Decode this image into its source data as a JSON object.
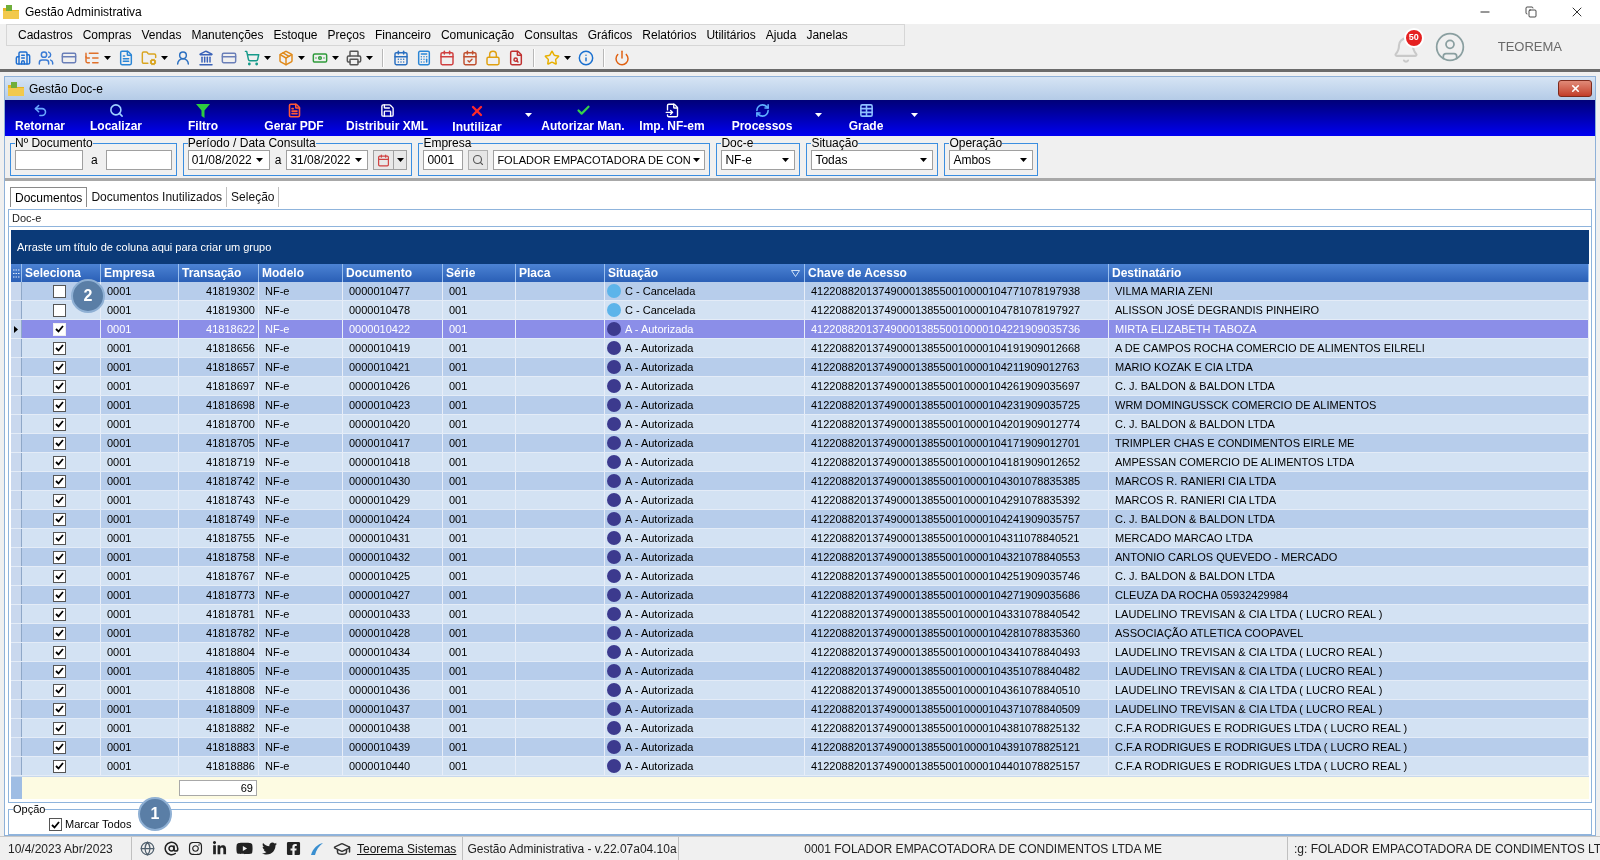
{
  "window": {
    "title": "Gestão Administrativa"
  },
  "menu": [
    "Cadastros",
    "Compras",
    "Vendas",
    "Manutenções",
    "Estoque",
    "Preços",
    "Financeiro",
    "Comunicação",
    "Consultas",
    "Gráficos",
    "Relatórios",
    "Utilitários",
    "Ajuda",
    "Janelas"
  ],
  "notifications": {
    "count": "50"
  },
  "user": {
    "name": "TEOREMA"
  },
  "doc_window": {
    "title": "Gestão Doc-e",
    "toolbar": [
      {
        "label": "Retornar",
        "dropdown": false
      },
      {
        "label": "Localizar",
        "dropdown": false
      },
      {
        "label": "Filtro",
        "dropdown": false
      },
      {
        "label": "Gerar PDF",
        "dropdown": false
      },
      {
        "label": "Distribuir XML",
        "dropdown": false
      },
      {
        "label": "Inutilizar",
        "dropdown": true
      },
      {
        "label": "Autorizar Man.",
        "dropdown": false
      },
      {
        "label": "Imp. NF-em",
        "dropdown": false
      },
      {
        "label": "Processos",
        "dropdown": true
      },
      {
        "label": "Grade",
        "dropdown": true
      }
    ],
    "filters": {
      "document_number": {
        "label": "Nº Documento",
        "separator": "a"
      },
      "period": {
        "label": "Período / Data Consulta",
        "from": "01/08/2022",
        "separator": "a",
        "to": "31/08/2022"
      },
      "company": {
        "label": "Empresa",
        "code": "0001",
        "name": "FOLADOR EMPACOTADORA DE CON"
      },
      "doc_type": {
        "label": "Doc-e",
        "value": "NF-e"
      },
      "status": {
        "label": "Situação",
        "value": "Todas"
      },
      "operation": {
        "label": "Operação",
        "value": "Ambos"
      }
    },
    "tabs": [
      {
        "label": "Documentos",
        "selected": true
      },
      {
        "label": "Documentos Inutilizados",
        "selected": false
      },
      {
        "label": "Seleção",
        "selected": false
      }
    ],
    "grid": {
      "group_label": "Doc-e",
      "group_hint": "Arraste um título de coluna aqui para criar um grupo",
      "columns": [
        {
          "title": "Seleciona",
          "filtered": false
        },
        {
          "title": "Empresa",
          "filtered": false
        },
        {
          "title": "Transação",
          "filtered": false
        },
        {
          "title": "Modelo",
          "filtered": false
        },
        {
          "title": "Documento",
          "filtered": false
        },
        {
          "title": "Série",
          "filtered": false
        },
        {
          "title": "Placa",
          "filtered": false
        },
        {
          "title": "Situação",
          "filtered": true
        },
        {
          "title": "Chave de Acesso",
          "filtered": false
        },
        {
          "title": "Destinatário",
          "filtered": false
        }
      ],
      "rows": [
        {
          "selected": false,
          "checked": false,
          "callout": "2",
          "empresa": "0001",
          "transacao": "41819302",
          "modelo": "NF-e",
          "documento": "0000010477",
          "serie": "001",
          "situacao": {
            "text": "C - Cancelada",
            "color": "#5cb4ea"
          },
          "chave": "41220882013749000138550010000104771078197938",
          "destinatario": "VILMA MARIA ZENI"
        },
        {
          "selected": false,
          "checked": false,
          "empresa": "0001",
          "transacao": "41819300",
          "modelo": "NF-e",
          "documento": "0000010478",
          "serie": "001",
          "situacao": {
            "text": "C - Cancelada",
            "color": "#5cb4ea"
          },
          "chave": "41220882013749000138550010000104781078197927",
          "destinatario": "ALISSON JOSÉ DEGRANDIS PINHEIRO"
        },
        {
          "selected": true,
          "checked": true,
          "empresa": "0001",
          "transacao": "41818622",
          "modelo": "NF-e",
          "documento": "0000010422",
          "serie": "001",
          "situacao": {
            "text": "A - Autorizada",
            "color": "#3c3a8e"
          },
          "chave": "41220882013749000138550010000104221909035736",
          "destinatario": "MIRTA ELIZABETH TABOZA"
        },
        {
          "selected": false,
          "checked": true,
          "empresa": "0001",
          "transacao": "41818656",
          "modelo": "NF-e",
          "documento": "0000010419",
          "serie": "001",
          "situacao": {
            "text": "A - Autorizada",
            "color": "#3c3a8e"
          },
          "chave": "41220882013749000138550010000104191909012668",
          "destinatario": "A DE CAMPOS ROCHA COMERCIO DE ALIMENTOS EILRELI"
        },
        {
          "selected": false,
          "checked": true,
          "empresa": "0001",
          "transacao": "41818657",
          "modelo": "NF-e",
          "documento": "0000010421",
          "serie": "001",
          "situacao": {
            "text": "A - Autorizada",
            "color": "#3c3a8e"
          },
          "chave": "41220882013749000138550010000104211909012763",
          "destinatario": "MARIO KOZAK E CIA LTDA"
        },
        {
          "selected": false,
          "checked": true,
          "empresa": "0001",
          "transacao": "41818697",
          "modelo": "NF-e",
          "documento": "0000010426",
          "serie": "001",
          "situacao": {
            "text": "A - Autorizada",
            "color": "#3c3a8e"
          },
          "chave": "41220882013749000138550010000104261909035697",
          "destinatario": "C. J. BALDON & BALDON LTDA"
        },
        {
          "selected": false,
          "checked": true,
          "empresa": "0001",
          "transacao": "41818698",
          "modelo": "NF-e",
          "documento": "0000010423",
          "serie": "001",
          "situacao": {
            "text": "A - Autorizada",
            "color": "#3c3a8e"
          },
          "chave": "41220882013749000138550010000104231909035725",
          "destinatario": "WRM DOMINGUSSCK COMERCIO DE ALIMENTOS"
        },
        {
          "selected": false,
          "checked": true,
          "empresa": "0001",
          "transacao": "41818700",
          "modelo": "NF-e",
          "documento": "0000010420",
          "serie": "001",
          "situacao": {
            "text": "A - Autorizada",
            "color": "#3c3a8e"
          },
          "chave": "41220882013749000138550010000104201909012774",
          "destinatario": "C. J. BALDON & BALDON LTDA"
        },
        {
          "selected": false,
          "checked": true,
          "empresa": "0001",
          "transacao": "41818705",
          "modelo": "NF-e",
          "documento": "0000010417",
          "serie": "001",
          "situacao": {
            "text": "A - Autorizada",
            "color": "#3c3a8e"
          },
          "chave": "41220882013749000138550010000104171909012701",
          "destinatario": "TRIMPLER CHAS E CONDIMENTOS EIRLE ME"
        },
        {
          "selected": false,
          "checked": true,
          "empresa": "0001",
          "transacao": "41818719",
          "modelo": "NF-e",
          "documento": "0000010418",
          "serie": "001",
          "situacao": {
            "text": "A - Autorizada",
            "color": "#3c3a8e"
          },
          "chave": "41220882013749000138550010000104181909012652",
          "destinatario": "AMPESSAN COMERCIO DE ALIMENTOS LTDA"
        },
        {
          "selected": false,
          "checked": true,
          "empresa": "0001",
          "transacao": "41818742",
          "modelo": "NF-e",
          "documento": "0000010430",
          "serie": "001",
          "situacao": {
            "text": "A - Autorizada",
            "color": "#3c3a8e"
          },
          "chave": "41220882013749000138550010000104301078835385",
          "destinatario": "MARCOS R. RANIERI CIA LTDA"
        },
        {
          "selected": false,
          "checked": true,
          "empresa": "0001",
          "transacao": "41818743",
          "modelo": "NF-e",
          "documento": "0000010429",
          "serie": "001",
          "situacao": {
            "text": "A - Autorizada",
            "color": "#3c3a8e"
          },
          "chave": "41220882013749000138550010000104291078835392",
          "destinatario": "MARCOS R. RANIERI CIA LTDA"
        },
        {
          "selected": false,
          "checked": true,
          "empresa": "0001",
          "transacao": "41818749",
          "modelo": "NF-e",
          "documento": "0000010424",
          "serie": "001",
          "situacao": {
            "text": "A - Autorizada",
            "color": "#3c3a8e"
          },
          "chave": "41220882013749000138550010000104241909035757",
          "destinatario": "C. J. BALDON & BALDON LTDA"
        },
        {
          "selected": false,
          "checked": true,
          "empresa": "0001",
          "transacao": "41818755",
          "modelo": "NF-e",
          "documento": "0000010431",
          "serie": "001",
          "situacao": {
            "text": "A - Autorizada",
            "color": "#3c3a8e"
          },
          "chave": "41220882013749000138550010000104311078840521",
          "destinatario": "MERCADO MARCAO LTDA"
        },
        {
          "selected": false,
          "checked": true,
          "empresa": "0001",
          "transacao": "41818758",
          "modelo": "NF-e",
          "documento": "0000010432",
          "serie": "001",
          "situacao": {
            "text": "A - Autorizada",
            "color": "#3c3a8e"
          },
          "chave": "41220882013749000138550010000104321078840553",
          "destinatario": "ANTONIO CARLOS QUEVEDO - MERCADO"
        },
        {
          "selected": false,
          "checked": true,
          "empresa": "0001",
          "transacao": "41818767",
          "modelo": "NF-e",
          "documento": "0000010425",
          "serie": "001",
          "situacao": {
            "text": "A - Autorizada",
            "color": "#3c3a8e"
          },
          "chave": "41220882013749000138550010000104251909035746",
          "destinatario": "C. J. BALDON & BALDON LTDA"
        },
        {
          "selected": false,
          "checked": true,
          "empresa": "0001",
          "transacao": "41818773",
          "modelo": "NF-e",
          "documento": "0000010427",
          "serie": "001",
          "situacao": {
            "text": "A - Autorizada",
            "color": "#3c3a8e"
          },
          "chave": "41220882013749000138550010000104271909035686",
          "destinatario": "CLEUZA DA ROCHA 05932429984"
        },
        {
          "selected": false,
          "checked": true,
          "empresa": "0001",
          "transacao": "41818781",
          "modelo": "NF-e",
          "documento": "0000010433",
          "serie": "001",
          "situacao": {
            "text": "A - Autorizada",
            "color": "#3c3a8e"
          },
          "chave": "41220882013749000138550010000104331078840542",
          "destinatario": "LAUDELINO TREVISAN & CIA LTDA ( LUCRO REAL )"
        },
        {
          "selected": false,
          "checked": true,
          "empresa": "0001",
          "transacao": "41818782",
          "modelo": "NF-e",
          "documento": "0000010428",
          "serie": "001",
          "situacao": {
            "text": "A - Autorizada",
            "color": "#3c3a8e"
          },
          "chave": "41220882013749000138550010000104281078835360",
          "destinatario": "ASSOCIAÇÃO ATLETICA COOPAVEL"
        },
        {
          "selected": false,
          "checked": true,
          "empresa": "0001",
          "transacao": "41818804",
          "modelo": "NF-e",
          "documento": "0000010434",
          "serie": "001",
          "situacao": {
            "text": "A - Autorizada",
            "color": "#3c3a8e"
          },
          "chave": "41220882013749000138550010000104341078840493",
          "destinatario": "LAUDELINO TREVISAN & CIA LTDA ( LUCRO REAL )"
        },
        {
          "selected": false,
          "checked": true,
          "empresa": "0001",
          "transacao": "41818805",
          "modelo": "NF-e",
          "documento": "0000010435",
          "serie": "001",
          "situacao": {
            "text": "A - Autorizada",
            "color": "#3c3a8e"
          },
          "chave": "41220882013749000138550010000104351078840482",
          "destinatario": "LAUDELINO TREVISAN & CIA LTDA ( LUCRO REAL )"
        },
        {
          "selected": false,
          "checked": true,
          "empresa": "0001",
          "transacao": "41818808",
          "modelo": "NF-e",
          "documento": "0000010436",
          "serie": "001",
          "situacao": {
            "text": "A - Autorizada",
            "color": "#3c3a8e"
          },
          "chave": "41220882013749000138550010000104361078840510",
          "destinatario": "LAUDELINO TREVISAN & CIA LTDA ( LUCRO REAL )"
        },
        {
          "selected": false,
          "checked": true,
          "empresa": "0001",
          "transacao": "41818809",
          "modelo": "NF-e",
          "documento": "0000010437",
          "serie": "001",
          "situacao": {
            "text": "A - Autorizada",
            "color": "#3c3a8e"
          },
          "chave": "41220882013749000138550010000104371078840509",
          "destinatario": "LAUDELINO TREVISAN & CIA LTDA ( LUCRO REAL )"
        },
        {
          "selected": false,
          "checked": true,
          "empresa": "0001",
          "transacao": "41818882",
          "modelo": "NF-e",
          "documento": "0000010438",
          "serie": "001",
          "situacao": {
            "text": "A - Autorizada",
            "color": "#3c3a8e"
          },
          "chave": "41220882013749000138550010000104381078825132",
          "destinatario": "C.F.A RODRIGUES E RODRIGUES LTDA ( LUCRO REAL )"
        },
        {
          "selected": false,
          "checked": true,
          "empresa": "0001",
          "transacao": "41818883",
          "modelo": "NF-e",
          "documento": "0000010439",
          "serie": "001",
          "situacao": {
            "text": "A - Autorizada",
            "color": "#3c3a8e"
          },
          "chave": "41220882013749000138550010000104391078825121",
          "destinatario": "C.F.A RODRIGUES E RODRIGUES LTDA ( LUCRO REAL )"
        },
        {
          "selected": false,
          "checked": true,
          "empresa": "0001",
          "transacao": "41818886",
          "modelo": "NF-e",
          "documento": "0000010440",
          "serie": "001",
          "situacao": {
            "text": "A - Autorizada",
            "color": "#3c3a8e"
          },
          "chave": "41220882013749000138550010000104401078825157",
          "destinatario": "C.F.A RODRIGUES E RODRIGUES LTDA ( LUCRO REAL )"
        }
      ],
      "summary": {
        "count": "69"
      }
    },
    "option": {
      "label": "Opção",
      "callout": "1",
      "checkbox": {
        "label": "Marcar Todos",
        "checked": true
      }
    }
  },
  "status_bar": {
    "date": "10/4/2023 Abr/2023",
    "link": "Teorema Sistemas",
    "version": "Gestão Administrativa - v.22.07a04.10a",
    "company": "0001 FOLADOR EMPACOTADORA DE CONDIMENTOS LTDA ME",
    "company_login": ":g: FOLADOR EMPACOTADORA DE CONDIMENTOS LT"
  }
}
